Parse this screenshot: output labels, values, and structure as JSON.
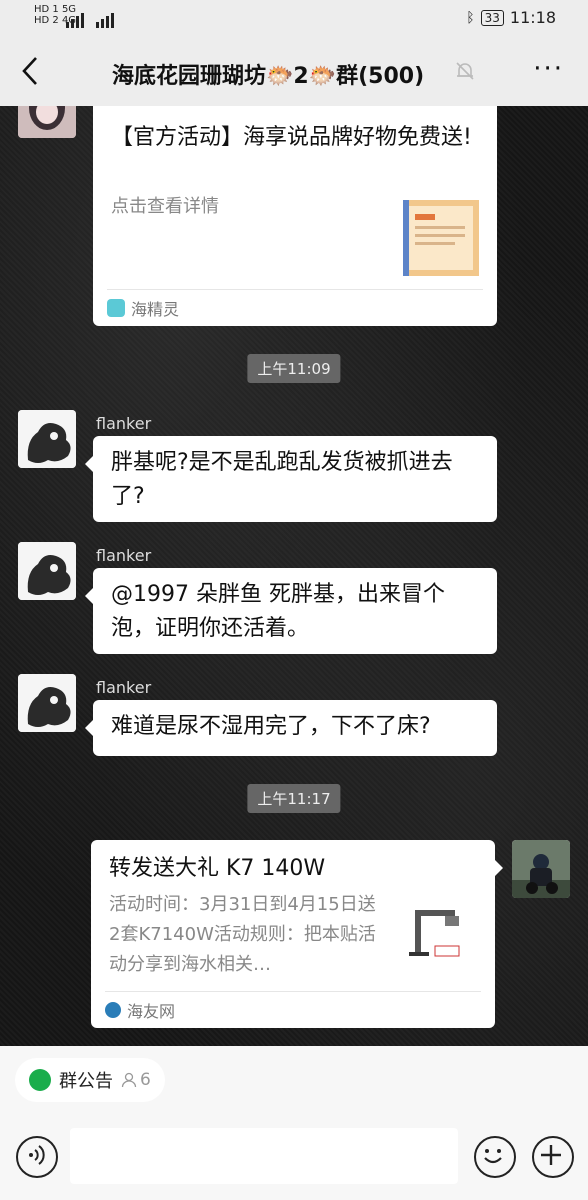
{
  "status": {
    "left_top": "HD 1 5G",
    "left_bottom": "HD 2 4G",
    "battery": "33",
    "clock": "11:18"
  },
  "header": {
    "title": "海底花园珊瑚坊🐡2🐡群(500)",
    "back_icon": "chevron-left-icon",
    "mute_icon": "bell-off-icon",
    "more_label": "···"
  },
  "messages": {
    "card1": {
      "title": "【官方活动】海享说品牌好物免费送!",
      "subtitle": "点击查看详情",
      "source": "海精灵"
    },
    "time1": "上午11:09",
    "msg1": {
      "nick": "flanker",
      "text": "胖基呢?是不是乱跑乱发货被抓进去了?"
    },
    "msg2": {
      "nick": "flanker",
      "text": "@1997 朵胖鱼  死胖基，出来冒个泡，证明你还活着。"
    },
    "msg3": {
      "nick": "flanker",
      "text": "难道是尿不湿用完了，下不了床?"
    },
    "time2": "上午11:17",
    "card2": {
      "title": "转发送大礼 K7 140W",
      "desc": "活动时间：3月31日到4月15日送2套K7140W活动规则：把本贴活动分享到海水相关…",
      "source": "海友网"
    }
  },
  "bottom": {
    "notice_label": "群公告",
    "notice_count": "6",
    "input_value": ""
  },
  "colors": {
    "accent_green": "#1aad4b",
    "header_bg": "#ededed"
  }
}
